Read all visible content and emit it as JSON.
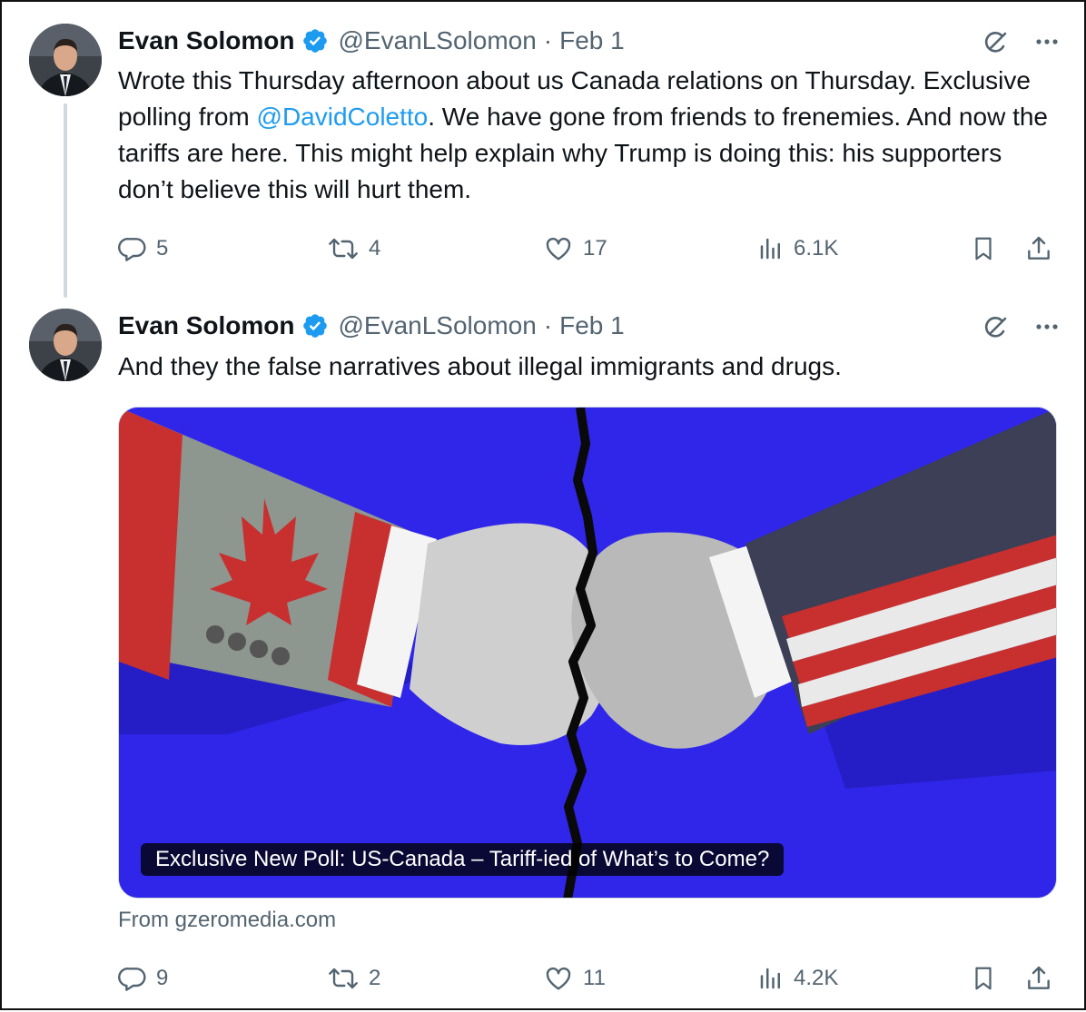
{
  "tweets": [
    {
      "author_name": "Evan Solomon",
      "handle": "@EvanLSolomon",
      "separator": "·",
      "date": "Feb 1",
      "text_parts": {
        "before_mention": "Wrote this Thursday afternoon about us Canada relations on Thursday. Exclusive polling from ",
        "mention": "@DavidColetto",
        "after_mention": ". We have gone from friends to frenemies. And now the tariffs are here. This might help explain why Trump is doing this: his supporters don’t believe this will hurt them."
      },
      "replies": "5",
      "reposts": "4",
      "likes": "17",
      "views": "6.1K"
    },
    {
      "author_name": "Evan Solomon",
      "handle": "@EvanLSolomon",
      "separator": "·",
      "date": "Feb 1",
      "text": "And they the false narratives about illegal immigrants and drugs.",
      "card": {
        "caption": "Exclusive New Poll: US-Canada – Tariff-ied of What’s to Come?",
        "source": "From gzeromedia.com"
      },
      "replies": "9",
      "reposts": "2",
      "likes": "11",
      "views": "4.2K"
    }
  ],
  "icons": {
    "verified": "verified-badge-icon",
    "grok": "grok-icon",
    "more": "more-icon",
    "reply": "reply-icon",
    "repost": "repost-icon",
    "like": "like-icon",
    "views": "views-icon",
    "bookmark": "bookmark-icon",
    "share": "share-icon"
  },
  "colors": {
    "link": "#1d9bf0",
    "secondary_text": "#536471",
    "card_background": "#2f26ea",
    "verified": "#1d9bf0"
  }
}
